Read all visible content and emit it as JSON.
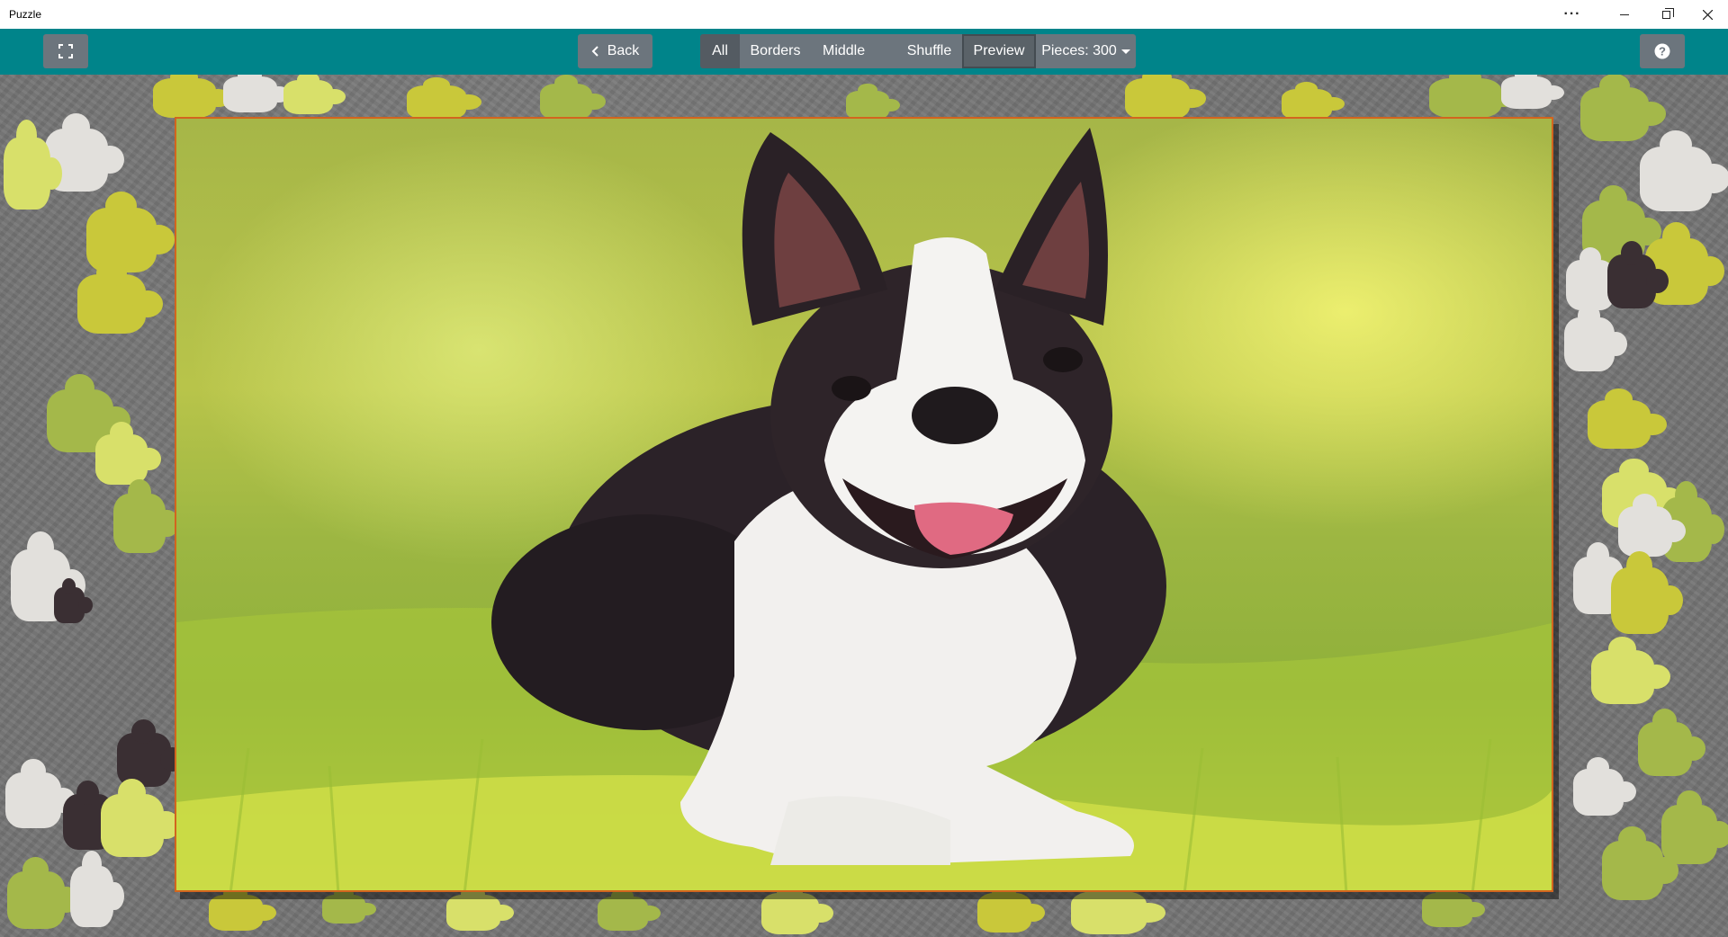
{
  "window": {
    "title": "Puzzle",
    "more_label": "···"
  },
  "toolbar": {
    "back_label": "Back",
    "filter_tabs": [
      {
        "label": "All",
        "active": true
      },
      {
        "label": "Borders",
        "active": false
      },
      {
        "label": "Middle",
        "active": false
      }
    ],
    "shuffle_label": "Shuffle",
    "preview_label": "Preview",
    "pieces_label": "Pieces: 300",
    "colors": {
      "bar": "#00848a",
      "button": "#6c757d",
      "button_active": "#545b62"
    }
  },
  "board": {
    "background": "#747474",
    "preview_border": "#d2651e",
    "icons": [
      "fullscreen-icon",
      "chevron-left-icon",
      "help-icon",
      "caret-down-icon"
    ]
  }
}
